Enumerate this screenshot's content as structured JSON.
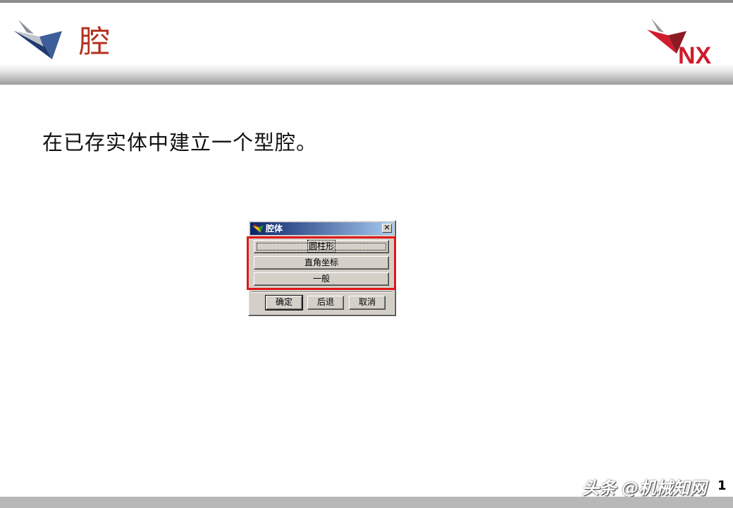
{
  "slide": {
    "title": "腔",
    "body_text": "在已存实体中建立一个型腔。",
    "page_number": "1",
    "watermark": "头条 @机械知网"
  },
  "dialog": {
    "title": "腔体",
    "close_label": "✕",
    "options": [
      {
        "label": "圆柱形"
      },
      {
        "label": "直角坐标"
      },
      {
        "label": "一般"
      }
    ],
    "actions": {
      "ok": "确定",
      "back": "后退",
      "cancel": "取消"
    }
  },
  "colors": {
    "title": "#b4321e",
    "highlight_box": "#e01818",
    "dialog_face": "#d4d0c8",
    "titlebar_start": "#0a246a",
    "titlebar_end": "#a6caf0"
  }
}
